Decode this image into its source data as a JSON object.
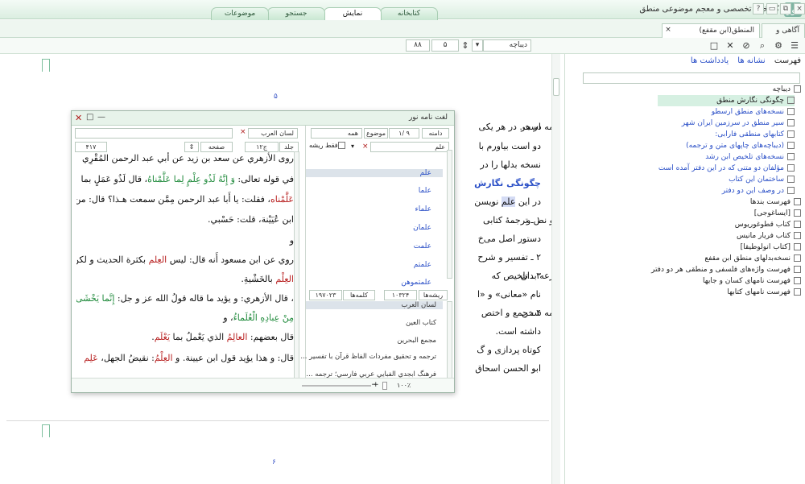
{
  "window": {
    "title": "کتابخانه تخصصی و معجم موضوعی منطق",
    "logo_glyph": "نور",
    "controls": [
      "×",
      "⧉",
      "▭",
      "?"
    ]
  },
  "main_tabs": [
    {
      "label": "کتابخانه"
    },
    {
      "label": "نمایش"
    },
    {
      "label": "جستجو"
    },
    {
      "label": "موضوعات"
    }
  ],
  "doc_tabs": [
    {
      "label": "المنطق(ابن مقفع)",
      "close": "×"
    },
    {
      "label": "آگاهی و گواهی"
    }
  ],
  "tab_close": "×",
  "toolbar": {
    "section_select": "دیباچه",
    "page_input": "۵",
    "zoom_input": "۸۸",
    "icons": [
      "☰",
      "⚙",
      "⌕",
      "⊘",
      "✕",
      "□"
    ]
  },
  "document": {
    "page_numbers": [
      "۵",
      "۶"
    ],
    "lines": [
      {
        "text": "است. در هر یکی",
        "right_text": "مه در هر"
      },
      {
        "text": "دو است بیاورم با",
        "right_text": ""
      },
      {
        "text": "نسخه بدلها را در",
        "right_text": ""
      },
      {
        "text": "چگونگی نگارش",
        "right_text": "",
        "heading": true
      },
      {
        "text": "در این",
        "highlight": "علم",
        "after": "نویسن",
        "right_text": ""
      },
      {
        "text": "۱ ـ ترجمهٔ کتابی",
        "right_text": "و نص و"
      },
      {
        "text": "دستور اصل می‌خ",
        "right_text": ""
      },
      {
        "text": "۲ ـ تفسیر و شرح",
        "right_text": ""
      },
      {
        "text": "۳ ـ تلخیص که",
        "right_text": "رعه بدان"
      },
      {
        "text": "نام «معانی» و «ا",
        "right_text": ""
      },
      {
        "text": "۴ ـ جمع و اختص",
        "right_text": "مه سخن"
      },
      {
        "text": "داشته است.",
        "right_text": ""
      },
      {
        "text": "کوتاه پردازی و گ",
        "right_text": ""
      },
      {
        "text": "ابو الحسن اسحاق",
        "right_text": ""
      }
    ]
  },
  "sidebar": {
    "header": [
      "فهرست",
      "نشانه ها",
      "یادداشت ها"
    ],
    "items": [
      {
        "label": "دیباچه",
        "level": 0,
        "selected": false
      },
      {
        "label": "چگونگی نگارش منطق",
        "level": 1,
        "selected": true
      },
      {
        "label": "نسخه‌های منطق ارسطو",
        "level": 1,
        "selected": false
      },
      {
        "label": "سیر منطق در سرزمین ایران شهر",
        "level": 1,
        "selected": false
      },
      {
        "label": "کتابهای منطقی فارابی:",
        "level": 1,
        "selected": false
      },
      {
        "label": "(دیباچه‌های چاپهای متن و ترجمه)",
        "level": 1,
        "selected": false
      },
      {
        "label": "نسخه‌های تلخیص ابن رشد",
        "level": 1,
        "selected": false
      },
      {
        "label": "مؤلفان دو متنی که در این دفتر آمده است",
        "level": 1,
        "selected": false
      },
      {
        "label": "ساختمان این کتاب",
        "level": 1,
        "selected": false
      },
      {
        "label": "در وصف این دو دفتر",
        "level": 1,
        "selected": false
      },
      {
        "label": "فهرست بندها",
        "level": 0,
        "selected": false
      },
      {
        "label": "[ایساغوجی]",
        "level": 0,
        "selected": false
      },
      {
        "label": "کتاب قطوغوریوس",
        "level": 0,
        "selected": false
      },
      {
        "label": "کتاب فریار مانیس",
        "level": 0,
        "selected": false
      },
      {
        "label": "[کتاب انولوطیقا]",
        "level": 0,
        "selected": false
      },
      {
        "label": "نسخه‌بدلهای منطق ابن مقفع",
        "level": 0,
        "selected": false
      },
      {
        "label": "فهرست واژه‌های فلسفی و منطقی هر دو دفتر",
        "level": 0,
        "selected": false
      },
      {
        "label": "فهرست نامهای کسان و جایها",
        "level": 0,
        "selected": false
      },
      {
        "label": "فهرست نامهای کتابها",
        "level": 0,
        "selected": false
      }
    ]
  },
  "dialog": {
    "title": "لغت نامه نور",
    "close": "✕",
    "controls": [
      "□",
      "—"
    ],
    "filters": {
      "scope": "دامنه",
      "position": "۱/ ۹",
      "field": "موضوع",
      "field_value": "همه",
      "root_only": "فقط ریشه",
      "word_label": "علم",
      "clear_icon": "×"
    },
    "source_select": "لسان العرب",
    "nav": {
      "volume": "جلد",
      "volume_value": "ج۱۲",
      "page": "صفحه",
      "page_value": "۴۱۷"
    },
    "words": [
      "علم",
      "علما",
      "علماء",
      "علمان",
      "علمت",
      "علمتم",
      "علمتموهن"
    ],
    "counts": {
      "roots_label": "ریشه‌ها",
      "roots_value": "۱۰۳۲۴",
      "words_label": "کلمه‌ها",
      "words_value": "۱۹۷۰۲۳"
    },
    "dictionaries": [
      "لسان العرب",
      "كتاب العين",
      "مجمع البحرين",
      "ترجمه و تحقيق مفردات الفاظ قرآن با تفسير ...",
      "فرهنگ ابجدي الفبايي عربي فارسي؛ ترجمه ..."
    ],
    "zoom": "۱۰۰٪",
    "arabic_lines": [
      {
        "parts": [
          {
            "t": "روى الأزهري عن سعد بن زيد عن أبي عبد الرحمن المُقْرِي"
          }
        ]
      },
      {
        "parts": [
          {
            "t": "في قوله تعالى: "
          },
          {
            "t": "وَ إِنَّهُ لَذُو عِلْمٍ لِما عَلَّمْناهُ",
            "c": "grn"
          },
          {
            "t": "، قال لَذُو عَمَلٍ بما"
          }
        ]
      },
      {
        "parts": [
          {
            "t": "عَلَّمْناه",
            "c": "red"
          },
          {
            "t": "، فقلت: يا أَبا عبد الرحمن مِمَّن سمعت هـذا؟ قال: من"
          }
        ]
      },
      {
        "parts": [
          {
            "t": "ابن عُيَيْنة، قلت: حَسْبي."
          }
        ]
      },
      {
        "parts": [
          {
            "t": "و"
          }
        ]
      },
      {
        "parts": [
          {
            "t": "روي عن ابن مسعود أَنه قال: ليس "
          },
          {
            "t": "العِلم",
            "c": "red"
          },
          {
            "t": " بكثرة الحديث و لكن"
          }
        ]
      },
      {
        "parts": [
          {
            "t": "العِلْم",
            "c": "red"
          },
          {
            "t": " بالخَشْيةِ."
          }
        ]
      },
      {
        "parts": [
          {
            "t": "، قال الأزهري: و يؤيد ما قاله قولُ الله عز و جل: "
          },
          {
            "t": "إِنَّما يَخْشَى اللَّهَ",
            "c": "grn"
          }
        ]
      },
      {
        "parts": [
          {
            "t": "مِنْ عِبادِهِ الْعُلَماءُ",
            "c": "grn"
          },
          {
            "t": "، و"
          }
        ]
      },
      {
        "parts": [
          {
            "t": "قال بعضهم: "
          },
          {
            "t": "العالِمُ",
            "c": "red"
          },
          {
            "t": " الذي يَعْملُ بما "
          },
          {
            "t": "يَعْلَم",
            "c": "red"
          },
          {
            "t": "."
          }
        ]
      },
      {
        "parts": [
          {
            "t": "قال: و هذا يؤيد قول ابن عيينة. و "
          },
          {
            "t": "العِلْمُ",
            "c": "red"
          },
          {
            "t": ": نقيضُ الجهل، "
          },
          {
            "t": "عَلِم",
            "c": "red"
          }
        ]
      }
    ]
  }
}
